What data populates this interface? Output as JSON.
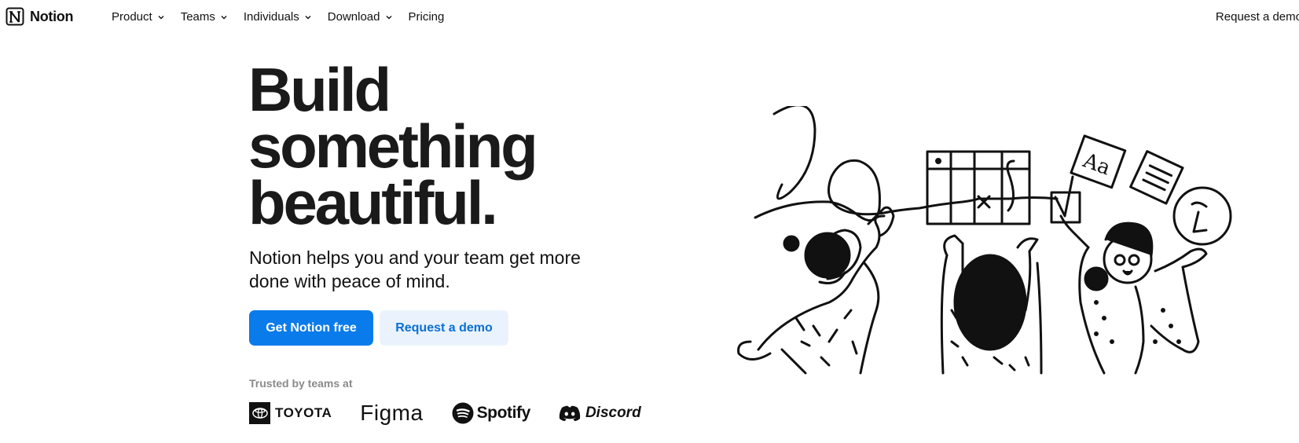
{
  "nav": {
    "brand": "Notion",
    "links": [
      {
        "label": "Product",
        "has_dropdown": true
      },
      {
        "label": "Teams",
        "has_dropdown": true
      },
      {
        "label": "Individuals",
        "has_dropdown": true
      },
      {
        "label": "Download",
        "has_dropdown": true
      },
      {
        "label": "Pricing",
        "has_dropdown": false
      }
    ],
    "right_link": "Request a demo"
  },
  "hero": {
    "title_lines": [
      "Build",
      "something",
      "beautiful."
    ],
    "subtitle_lines": [
      "Notion helps you and your team get more",
      "done with peace of mind."
    ],
    "primary_cta": "Get Notion free",
    "secondary_cta": "Request a demo",
    "trusted_label": "Trusted by teams at",
    "trusted_logos": [
      "TOYOTA",
      "Figma",
      "Spotify",
      "Discord"
    ]
  },
  "colors": {
    "accent": "#0a7bea",
    "accent_light": "#eaf3fd",
    "text": "#111111",
    "muted": "#8a8a8a"
  },
  "icons": [
    "notion-logo-icon",
    "chevron-down-icon",
    "toyota-logo-icon",
    "spotify-logo-icon",
    "discord-logo-icon"
  ]
}
